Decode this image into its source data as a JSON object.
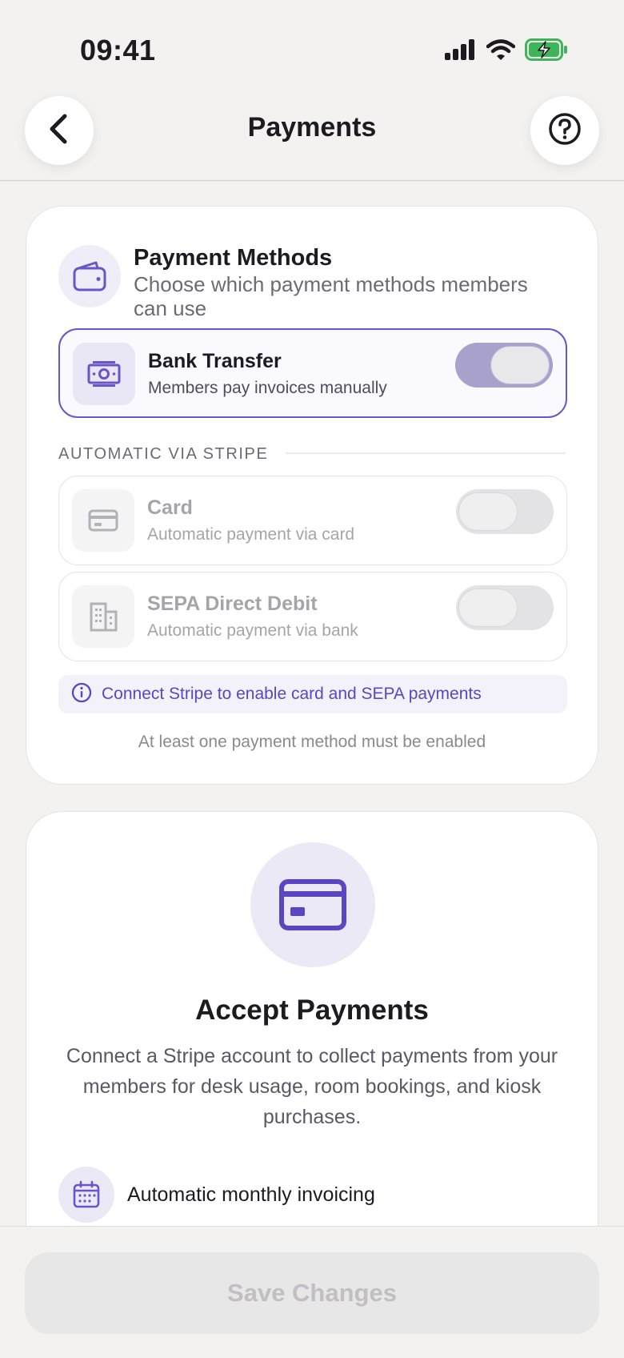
{
  "status_bar": {
    "time": "09:41",
    "icons": [
      "signal-icon",
      "wifi-icon",
      "battery-charging-icon"
    ]
  },
  "header": {
    "title": "Payments",
    "back_icon": "chevron-left-icon",
    "help_icon": "question-circle-icon"
  },
  "payment_methods": {
    "title": "Payment Methods",
    "subtitle": "Choose which payment methods members can use",
    "icon": "wallet-icon",
    "bank_transfer": {
      "title": "Bank Transfer",
      "description": "Members pay invoices manually",
      "icon": "banknote-icon",
      "enabled": true
    },
    "section_label": "AUTOMATIC VIA STRIPE",
    "card": {
      "title": "Card",
      "description": "Automatic payment via card",
      "icon": "credit-card-icon",
      "enabled": false
    },
    "sepa": {
      "title": "SEPA Direct Debit",
      "description": "Automatic payment via bank",
      "icon": "building-icon",
      "enabled": false
    },
    "info_text": "Connect Stripe to enable card and SEPA payments",
    "footnote": "At least one payment method must be enabled"
  },
  "accept_payments": {
    "icon": "credit-card-icon",
    "title": "Accept Payments",
    "description": "Connect a Stripe account to collect payments from your members for desk usage, room bookings, and kiosk purchases.",
    "features": [
      {
        "icon": "calendar-icon",
        "label": "Automatic monthly invoicing"
      }
    ]
  },
  "footer": {
    "save_label": "Save Changes"
  },
  "colors": {
    "accent": "#5b45c2",
    "accent_light": "#ece9f7",
    "background": "#f3f2f0"
  }
}
